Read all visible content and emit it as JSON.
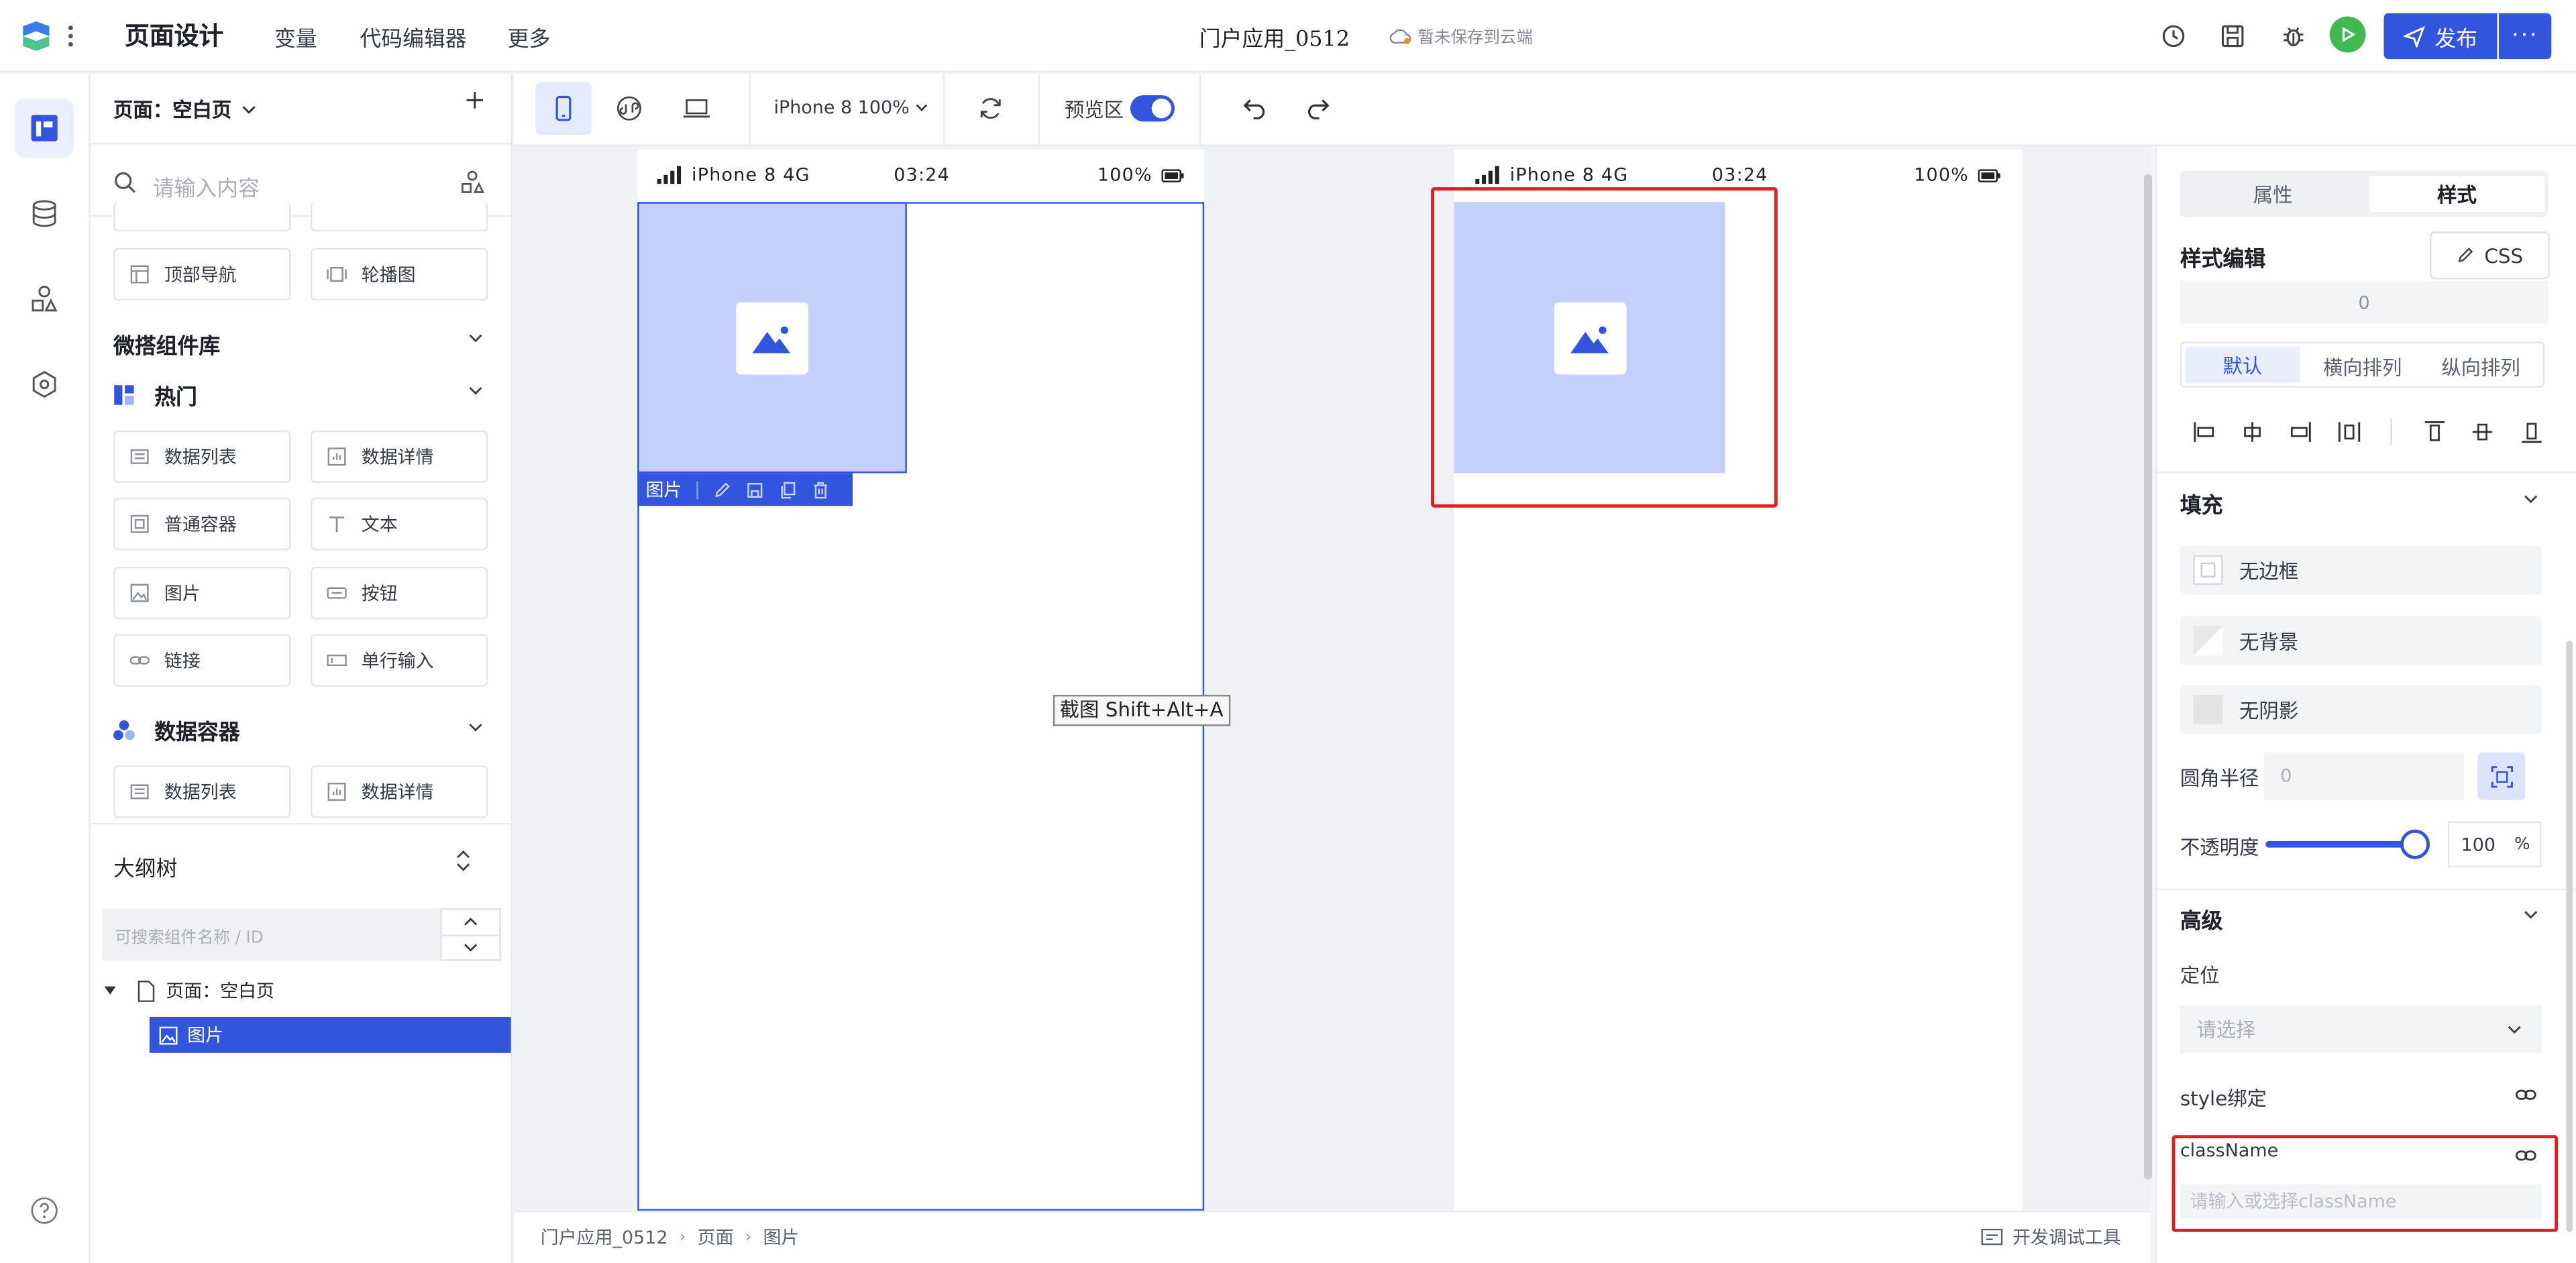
{
  "topbar": {
    "title": "页面设计",
    "menus": [
      "变量",
      "代码编辑器",
      "更多"
    ],
    "app_name": "门户应用_0512",
    "save_status": "暂未保存到云端",
    "publish_label": "发布",
    "more_label": "···"
  },
  "left_panel": {
    "page_select": "页面：空白页",
    "search_placeholder": "请输入内容",
    "top_components": [
      "顶部导航",
      "轮播图"
    ],
    "library_title": "微搭组件库",
    "hot_title": "热门",
    "hot_components": [
      "数据列表",
      "数据详情",
      "普通容器",
      "文本",
      "图片",
      "按钮",
      "链接",
      "单行输入"
    ],
    "data_container_title": "数据容器",
    "data_container_components": [
      "数据列表",
      "数据详情"
    ],
    "outline_title": "大纲树",
    "outline_search_placeholder": "可搜索组件名称 / ID",
    "tree_page": "页面：空白页",
    "tree_image": "图片"
  },
  "toolbar": {
    "device": "iPhone 8 100%",
    "preview_label": "预览区"
  },
  "canvas": {
    "status_left": "iPhone 8  4G",
    "status_time": "03:24",
    "status_battery": "100%",
    "image_toolbar_label": "图片",
    "tooltip": "截图 Shift+Alt+A"
  },
  "bottombar": {
    "crumbs": [
      "门户应用_0512",
      "页面",
      "图片"
    ],
    "devtool": "开发调试工具"
  },
  "right_panel": {
    "tabs": [
      "属性",
      "样式"
    ],
    "style_title": "样式编辑",
    "css_label": "CSS",
    "zero_value": "0",
    "layout_tabs": [
      "默认",
      "横向排列",
      "纵向排列"
    ],
    "fill_title": "填充",
    "fill_rows": [
      "无边框",
      "无背景",
      "无阴影"
    ],
    "radius_label": "圆角半径",
    "radius_placeholder": "0",
    "opacity_label": "不透明度",
    "opacity_value": "100",
    "opacity_unit": "%",
    "advanced_title": "高级",
    "position_label": "定位",
    "position_placeholder": "请选择",
    "style_bind_label": "style绑定",
    "classname_label": "className",
    "classname_placeholder": "请输入或选择className"
  },
  "colors": {
    "accent": "#3355dd",
    "image_fill": "#c3d0fb",
    "highlight_box": "#e02020",
    "run_button": "#3fb950"
  }
}
